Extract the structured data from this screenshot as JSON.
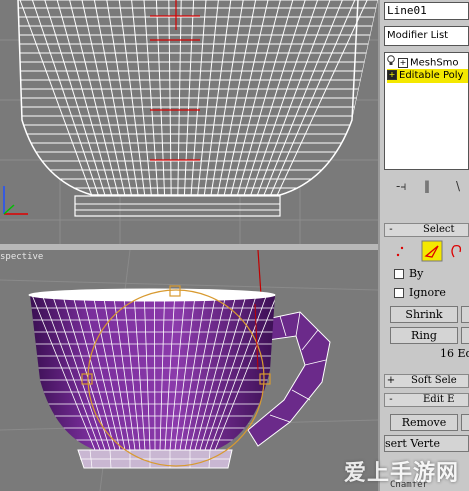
{
  "viewports": {
    "perspective_label": "spective",
    "bottom_label": "Chamfer"
  },
  "command_panel": {
    "object_name": "Line01",
    "modifier_list": "Modifier List",
    "stack": [
      {
        "label": "MeshSmo",
        "selected": false
      },
      {
        "label": "Editable Poly",
        "selected": true
      }
    ],
    "selection": {
      "header": "Select",
      "by_label": "By",
      "ignore_label": "Ignore",
      "shrink_label": "Shrink",
      "ring_label": "Ring",
      "count_label": "16 Ed"
    },
    "soft_selection_header": "Soft Sele",
    "edit_edges": {
      "header": "Edit E",
      "remove_label": "Remove",
      "insert_vertex_label": "sert Verte"
    }
  },
  "watermark": "爱上手游网",
  "colors": {
    "viewport_bg": "#7a7a7a",
    "cup_purple": "#6b2a8a",
    "selection_yellow": "#f4e800"
  }
}
